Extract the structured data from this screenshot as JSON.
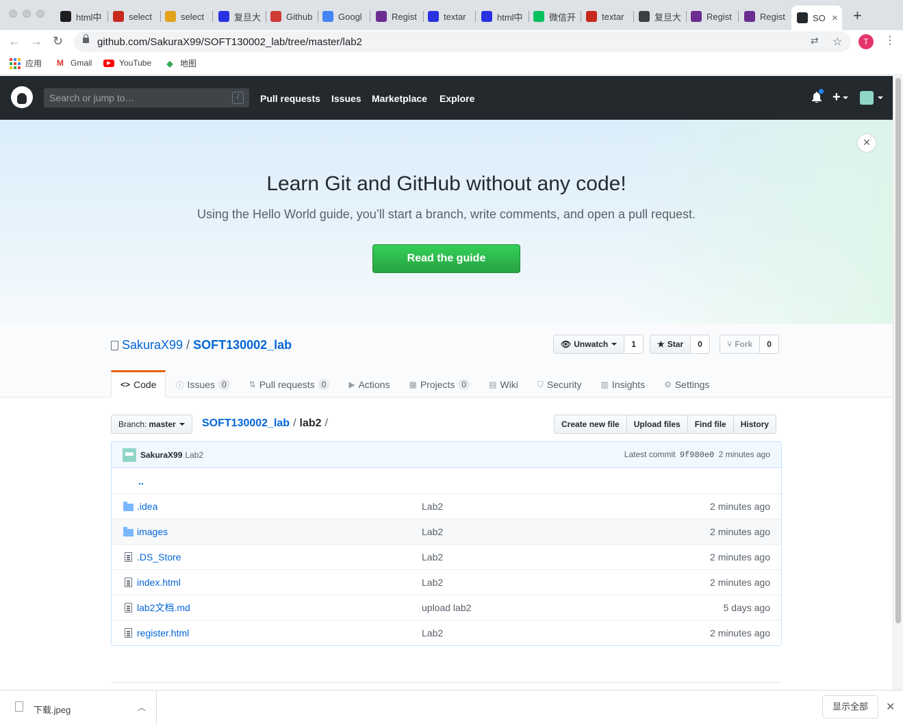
{
  "browser": {
    "tabs": [
      {
        "title": "html中",
        "icon": "mdn-icon",
        "color": "#1f1f1f"
      },
      {
        "title": "select",
        "icon": "csdn-icon",
        "color": "#c7291d"
      },
      {
        "title": "select",
        "icon": "colorful-icon",
        "color": "#e3a21a"
      },
      {
        "title": "复旦大",
        "icon": "baidu-paw-icon",
        "color": "#2932e1"
      },
      {
        "title": "Github",
        "icon": "ring-icon",
        "color": "#d03a35"
      },
      {
        "title": "Googl",
        "icon": "google-translate-icon",
        "color": "#4285f4"
      },
      {
        "title": "Regist",
        "icon": "phpstorm-icon",
        "color": "#6b2d8f"
      },
      {
        "title": "textar",
        "icon": "baidu-paw-icon",
        "color": "#2932e1"
      },
      {
        "title": "html中",
        "icon": "baidu-paw-icon",
        "color": "#2932e1"
      },
      {
        "title": "微信开",
        "icon": "wechat-icon",
        "color": "#07c160"
      },
      {
        "title": "textar",
        "icon": "csdn-icon",
        "color": "#c7291d"
      },
      {
        "title": "复旦大",
        "icon": "globe-icon",
        "color": "#3c4043"
      },
      {
        "title": "Regist",
        "icon": "phpstorm-icon",
        "color": "#6b2d8f"
      },
      {
        "title": "Regist",
        "icon": "phpstorm-icon",
        "color": "#6b2d8f"
      },
      {
        "title": "SO",
        "icon": "github-icon",
        "color": "#24292e",
        "active": true
      }
    ],
    "url": "github.com/SakuraX99/SOFT130002_lab/tree/master/lab2",
    "profile_initial": "T",
    "bookmarks": [
      {
        "label": "应用",
        "icon": "apps-icon"
      },
      {
        "label": "Gmail",
        "icon": "gmail-icon"
      },
      {
        "label": "YouTube",
        "icon": "youtube-icon"
      },
      {
        "label": "地图",
        "icon": "maps-icon"
      }
    ]
  },
  "github_header": {
    "search_placeholder": "Search or jump to…",
    "slash_key": "/",
    "nav": [
      "Pull requests",
      "Issues",
      "Marketplace",
      "Explore"
    ]
  },
  "banner": {
    "title": "Learn Git and GitHub without any code!",
    "subtitle": "Using the Hello World guide, you’ll start a branch, write comments, and open a pull request.",
    "button": "Read the guide"
  },
  "repo": {
    "owner": "SakuraX99",
    "separator": "/",
    "name": "SOFT130002_lab",
    "watch_label": "Unwatch",
    "watch_count": "1",
    "star_label": "Star",
    "star_count": "0",
    "fork_label": "Fork",
    "fork_count": "0",
    "tabs": [
      {
        "label": "Code",
        "icon": "code-icon"
      },
      {
        "label": "Issues",
        "icon": "issue-icon",
        "count": "0"
      },
      {
        "label": "Pull requests",
        "icon": "pull-request-icon",
        "count": "0"
      },
      {
        "label": "Actions",
        "icon": "play-icon"
      },
      {
        "label": "Projects",
        "icon": "project-icon",
        "count": "0"
      },
      {
        "label": "Wiki",
        "icon": "book-icon"
      },
      {
        "label": "Security",
        "icon": "shield-icon"
      },
      {
        "label": "Insights",
        "icon": "graph-icon"
      },
      {
        "label": "Settings",
        "icon": "gear-icon"
      }
    ]
  },
  "file_nav": {
    "branch_label": "Branch:",
    "branch": "master",
    "crumb_root": "SOFT130002_lab",
    "crumb_sep": "/",
    "crumb_current": "lab2",
    "buttons": [
      "Create new file",
      "Upload files",
      "Find file",
      "History"
    ]
  },
  "commit": {
    "author": "SakuraX99",
    "message": "Lab2",
    "latest_label": "Latest commit",
    "sha": "9f980e0",
    "age": "2 minutes ago"
  },
  "files": {
    "up": "..",
    "rows": [
      {
        "name": ".idea",
        "type": "dir",
        "message": "Lab2",
        "age": "2 minutes ago"
      },
      {
        "name": "images",
        "type": "dir",
        "message": "Lab2",
        "age": "2 minutes ago"
      },
      {
        "name": ".DS_Store",
        "type": "file",
        "message": "Lab2",
        "age": "2 minutes ago"
      },
      {
        "name": "index.html",
        "type": "file",
        "message": "Lab2",
        "age": "2 minutes ago"
      },
      {
        "name": "lab2文档.md",
        "type": "file",
        "message": "upload lab2",
        "age": "5 days ago"
      },
      {
        "name": "register.html",
        "type": "file",
        "message": "Lab2",
        "age": "2 minutes ago"
      }
    ]
  },
  "download_shelf": {
    "filename": "下载.jpeg",
    "show_all": "显示全部"
  }
}
